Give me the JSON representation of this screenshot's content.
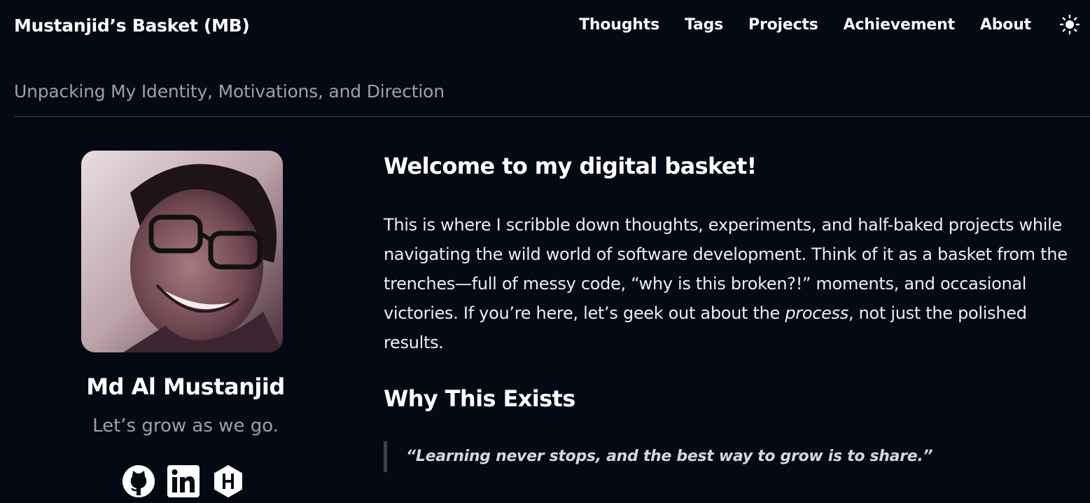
{
  "header": {
    "brand": "Mustanjid’s Basket (MB)",
    "nav": [
      {
        "label": "Thoughts"
      },
      {
        "label": "Tags"
      },
      {
        "label": "Projects"
      },
      {
        "label": "Achievement"
      },
      {
        "label": "About"
      }
    ],
    "theme_icon": "sun-icon"
  },
  "page": {
    "subtitle": "Unpacking My Identity, Motivations, and Direction"
  },
  "profile": {
    "avatar_icon": "profile-photo",
    "name": "Md Al Mustanjid",
    "tagline": "Let’s grow as we go.",
    "socials": [
      {
        "icon": "github-icon"
      },
      {
        "icon": "linkedin-icon"
      },
      {
        "icon": "hashnode-icon"
      }
    ]
  },
  "content": {
    "welcome_heading": "Welcome to my digital basket!",
    "intro_before": "This is where I scribble down thoughts, experiments, and half-baked projects while navigating the wild world of software development. Think of it as a basket from the trenches—full of messy code, “why is this broken?!” moments, and occasional victories. If you’re here, let’s geek out about the ",
    "intro_em": "process",
    "intro_after": ", not just the polished results.",
    "why_heading": "Why This Exists",
    "quote": "“Learning never stops, and the best way to grow is to share.”"
  },
  "colors": {
    "background": "#050914",
    "text": "#f4f5f8",
    "muted": "#9aa1ae",
    "divider": "#3a3f4b"
  }
}
